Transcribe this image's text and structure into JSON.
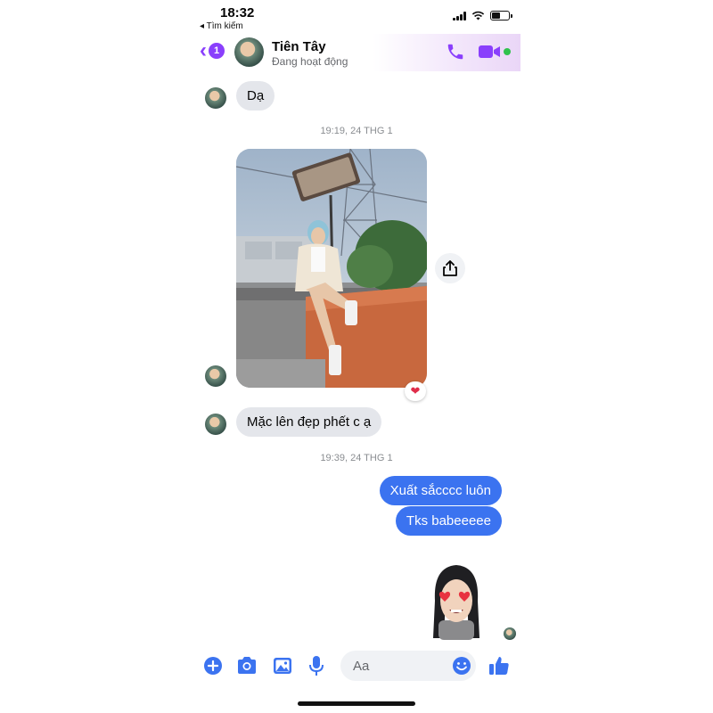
{
  "status_bar": {
    "time": "18:32",
    "back_app_label": "◂ Tìm kiếm",
    "battery_level": 0.5
  },
  "header": {
    "back_badge": "1",
    "contact_name": "Tiên Tây",
    "contact_status": "Đang hoạt động",
    "icons": [
      "back-chevron-icon",
      "phone-icon",
      "video-camera-icon"
    ]
  },
  "messages": {
    "first_reply": "Dạ",
    "timestamp_1": "19:19, 24 THG 1",
    "photo_reaction": "❤",
    "second_reply": "Mặc lên đẹp phết c ạ",
    "timestamp_2": "19:39, 24 THG 1",
    "sent_1": "Xuất sắcccc luôn",
    "sent_2": "Tks babeeeee"
  },
  "composer": {
    "placeholder": "Aa",
    "icons": [
      "plus-icon",
      "camera-icon",
      "image-icon",
      "microphone-icon",
      "emoji-icon",
      "thumbs-up-icon"
    ]
  },
  "colors": {
    "accent_purple": "#8a3ffc",
    "sent_bubble": "#3b73f0",
    "received_bubble": "#e4e6eb",
    "online": "#31c24d"
  }
}
